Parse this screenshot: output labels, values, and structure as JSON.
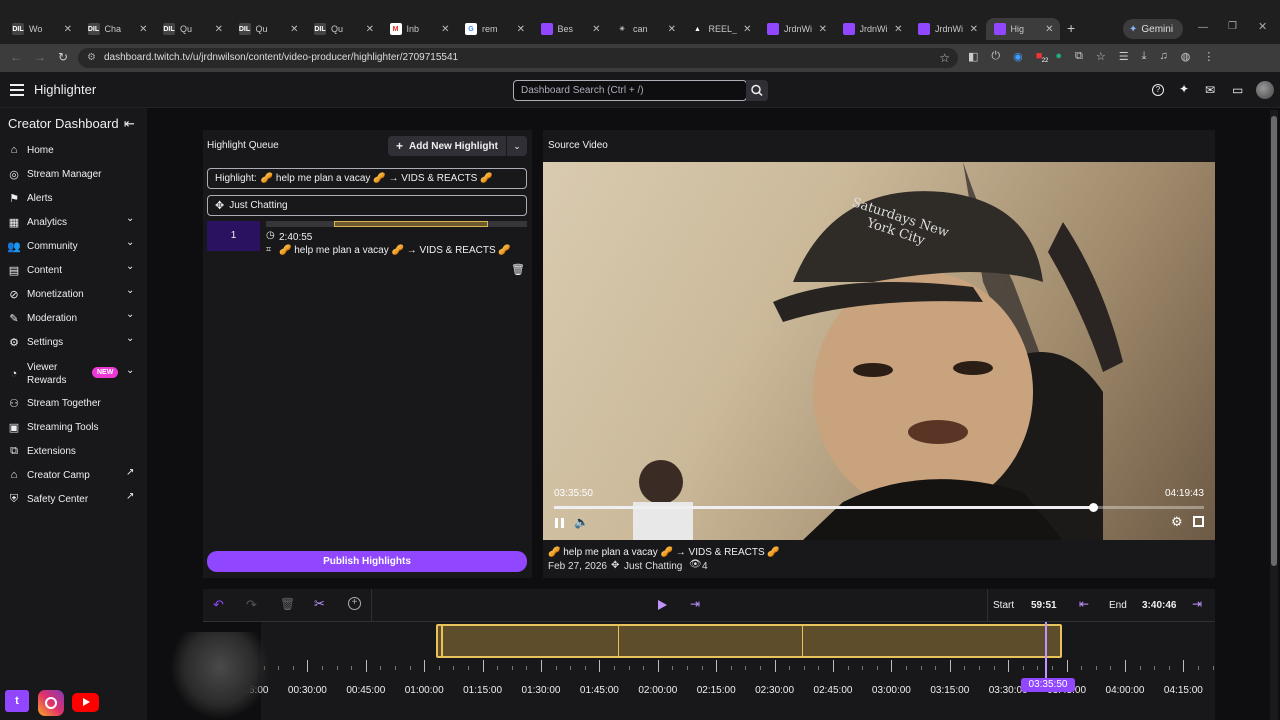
{
  "browser": {
    "tabs": [
      {
        "label": "Wo",
        "fav": "DIL"
      },
      {
        "label": "Cha",
        "fav": "DIL"
      },
      {
        "label": "Qu",
        "fav": "DIL"
      },
      {
        "label": "Qu",
        "fav": "DIL"
      },
      {
        "label": "Qu",
        "fav": "DIL"
      },
      {
        "label": "Inb",
        "fav": "M"
      },
      {
        "label": "rem",
        "fav": "G"
      },
      {
        "label": "Bes",
        "fav": ""
      },
      {
        "label": "can",
        "fav": "✳"
      },
      {
        "label": "REEL_0",
        "fav": "▲"
      },
      {
        "label": "JrdnWi",
        "fav": ""
      },
      {
        "label": "JrdnWi",
        "fav": ""
      },
      {
        "label": "JrdnWi",
        "fav": ""
      },
      {
        "label": "Hig",
        "fav": ""
      }
    ],
    "new_tab": "+",
    "gemini_label": "Gemini",
    "url": "dashboard.twitch.tv/u/jrdnwilson/content/video-producer/highlighter/2709715541",
    "ext_badge": "22"
  },
  "header": {
    "title": "Highlighter",
    "search_placeholder": "Dashboard Search (Ctrl + /)"
  },
  "sidebar": {
    "title": "Creator Dashboard",
    "items": [
      {
        "label": "Home",
        "icon": "home-icon",
        "chevron": false
      },
      {
        "label": "Stream Manager",
        "icon": "broadcast-icon",
        "chevron": false
      },
      {
        "label": "Alerts",
        "icon": "alerts-icon",
        "chevron": false
      },
      {
        "label": "Analytics",
        "icon": "analytics-icon",
        "chevron": true
      },
      {
        "label": "Community",
        "icon": "community-icon",
        "chevron": true
      },
      {
        "label": "Content",
        "icon": "content-icon",
        "chevron": true
      },
      {
        "label": "Monetization",
        "icon": "monetization-icon",
        "chevron": true
      },
      {
        "label": "Moderation",
        "icon": "moderation-icon",
        "chevron": true
      },
      {
        "label": "Settings",
        "icon": "settings-icon",
        "chevron": true
      },
      {
        "label": "Viewer",
        "label2": "Rewards",
        "icon": "rewards-icon",
        "chevron": true,
        "badge": "NEW"
      },
      {
        "label": "Stream Together",
        "icon": "stream-together-icon",
        "chevron": false
      },
      {
        "label": "Streaming Tools",
        "icon": "tools-icon",
        "chevron": false
      },
      {
        "label": "Extensions",
        "icon": "extensions-icon",
        "chevron": false
      },
      {
        "label": "Creator Camp",
        "icon": "creator-camp-icon",
        "chevron": false,
        "external": true
      },
      {
        "label": "Safety Center",
        "icon": "safety-icon",
        "chevron": false,
        "external": true
      }
    ]
  },
  "queue": {
    "title": "Highlight Queue",
    "add_button": "Add New Highlight",
    "highlight_title_prefix": "Highlight:",
    "highlight_title": "🥜 help me plan a vacay 🥜 → VIDS & REACTS 🥜",
    "category": "Just Chatting",
    "item": {
      "index": "1",
      "duration": "2:40:55",
      "title": "🥜 help me plan a vacay 🥜 → VIDS & REACTS 🥜",
      "segment_start_fraction": 0.26,
      "segment_end_fraction": 0.85
    },
    "publish_button": "Publish Highlights"
  },
  "source": {
    "title": "Source Video",
    "current_time": "03:35:50",
    "total_time": "04:19:43",
    "progress_fraction": 0.829,
    "buffered_fraction": 0.28,
    "video_title": "🥜 help me plan a vacay 🥜 → VIDS & REACTS 🥜",
    "date": "Feb 27, 2026",
    "category": "Just Chatting",
    "views": "4",
    "cap_text": "Saturdays New York City"
  },
  "editor": {
    "start_label": "Start",
    "start_value": "59:51",
    "end_label": "End",
    "end_value": "3:40:46",
    "playhead_label": "03:35:50",
    "tick_labels": [
      "00:15:00",
      "00:30:00",
      "00:45:00",
      "01:00:00",
      "01:15:00",
      "01:30:00",
      "01:45:00",
      "02:00:00",
      "02:15:00",
      "02:30:00",
      "02:45:00",
      "03:00:00",
      "03:15:00",
      "03:30:00",
      "03:45:00",
      "04:00:00",
      "04:15:00"
    ]
  },
  "colors": {
    "accent": "#9147ff",
    "highlight_fill": "#5e4d2a",
    "highlight_border": "#e8c25a",
    "background": "#0e0e10",
    "panel": "#18181b"
  }
}
